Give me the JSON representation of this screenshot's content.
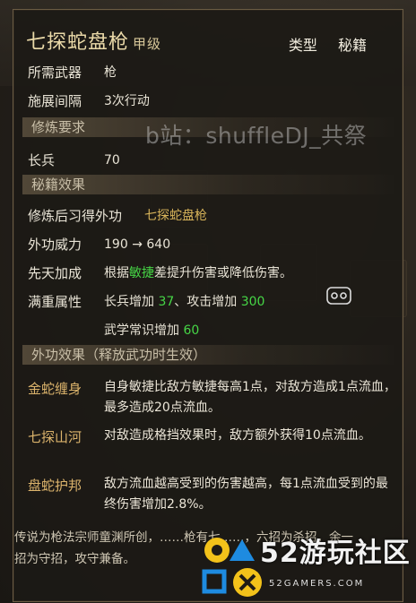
{
  "skill": {
    "name": "七探蛇盘枪",
    "grade": "甲级"
  },
  "tabs": [
    "类型",
    "秘籍"
  ],
  "watermark": "b站：shuffleDJ_共祭",
  "attrs": {
    "weapon_label": "所需武器",
    "weapon_value": "枪",
    "interval_label": "施展间隔",
    "interval_value": "3次行动"
  },
  "sections": {
    "requirement": "修炼要求",
    "secret": "秘籍效果",
    "outer": "外功效果（释放武功时生效）"
  },
  "requirement": {
    "label": "长兵",
    "value": "70"
  },
  "secret": {
    "learn_label": "修炼后习得外功",
    "learn_value": "七探蛇盘枪",
    "power_label": "外功威力",
    "power_from": "190",
    "power_arrow": "→",
    "power_to": "640",
    "innate_label": "先天加成",
    "innate_pre": "根据",
    "innate_highlight": "敏捷",
    "innate_post": "差提升伤害或降低伤害。",
    "full_label": "满重属性",
    "full_a": "长兵增加",
    "full_a_val": "37",
    "full_sep": "、攻击增加",
    "full_b_val": "300",
    "full_c": "武学常识增加",
    "full_c_val": "60"
  },
  "effects": [
    {
      "label": "金蛇缠身",
      "text": "自身敏捷比敌方敏捷每高1点，对敌方造成1点流血，最多造成20点流血。"
    },
    {
      "label": "七探山河",
      "text": "对敌造成格挡效果时，敌方额外获得10点流血。"
    },
    {
      "label": "盘蛇护邦",
      "text": "敌方流血越高受到的伤害越高，每1点流血受到的最终伤害增加2.8%。"
    }
  ],
  "lore": "传说为枪法宗师童渊所创，……枪有七……，六招为杀招，余一招为守招，攻守兼备。",
  "logo": {
    "text": "52游玩社区",
    "sub": "52GAMERS.COM"
  },
  "colors": {
    "gold": "#d8b45a",
    "green": "#46d646",
    "label_gold": "#dcb46c"
  }
}
